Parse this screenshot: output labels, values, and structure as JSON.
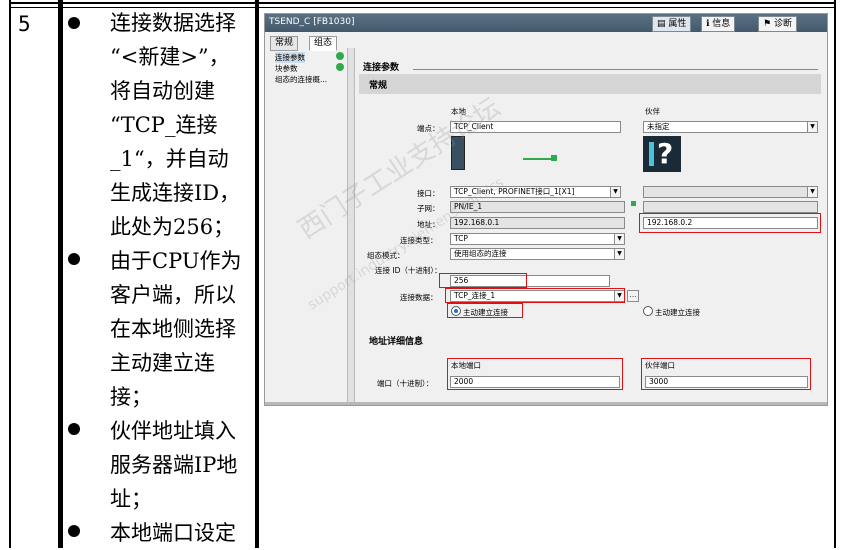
{
  "row": {
    "step_number": "5",
    "lines": [
      "连接数据选择",
      "“<新建>”，",
      "将自动创建",
      "“TCP_连接",
      "_1“，并自动",
      "生成连接ID，",
      "此处为256；",
      "由于CPU作为",
      "客户端，所以",
      "在本地侧选择",
      "主动建立连",
      "接；",
      "伙伴地址填入",
      "服务器端IP地",
      "址；",
      "本地端口设定"
    ]
  },
  "screenshot": {
    "window_title": "TSEND_C [FB1030]",
    "top_tabs": [
      "属性",
      "信息",
      "诊断"
    ],
    "sub_tabs": [
      "常规",
      "组态"
    ],
    "nav_items": [
      "连接参数",
      "块参数",
      "组态的连接概..."
    ],
    "section_title": "连接参数",
    "general_title": "常规",
    "col_local": "本地",
    "col_partner": "伙伴",
    "labels": {
      "endpoint": "端点：",
      "interface": "接口：",
      "subnet": "子网：",
      "address": "地址：",
      "conn_type": "连接类型：",
      "config_mode": "组态模式：",
      "conn_id": "连接 ID（十进制）：",
      "conn_data": "连接数据：",
      "addr_detail": "地址详细信息",
      "port_label": "端口（十进制）：",
      "local_port": "本地端口",
      "partner_port": "伙伴端口"
    },
    "values": {
      "endpoint_local": "TCP_Client",
      "endpoint_partner": "未指定",
      "interface_local": "TCP_Client, PROFINET接口_1[X1]",
      "subnet_local": "PN/IE_1",
      "address_local": "192.168.0.1",
      "address_partner": "192.168.0.2",
      "conn_type": "TCP",
      "config_mode": "使用组态的连接",
      "conn_id": "256",
      "conn_data": "TCP_连接_1",
      "radio_local": "主动建立连接",
      "radio_partner": "主动建立连接",
      "local_port": "2000",
      "partner_port": "3000"
    },
    "partner_device_glyph": "?"
  },
  "watermark": {
    "main": "西门子工业支持论坛",
    "sub": "support.industry.siemens.com/cs"
  }
}
